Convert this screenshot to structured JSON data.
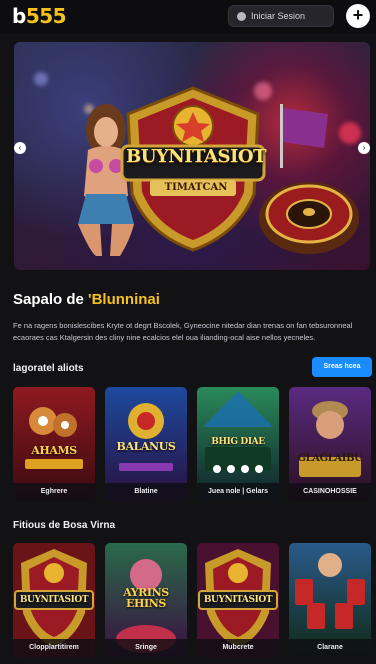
{
  "header": {
    "logo_part1": "b",
    "logo_part2": "555",
    "login_label": "Iniciar Sesion",
    "add_icon": "+"
  },
  "banner": {
    "title": "BUYNITASIOT",
    "subtitle": "TIMATCAN",
    "prev_icon": "‹",
    "next_icon": "›"
  },
  "intro": {
    "headline_part1": "Sapalo de",
    "headline_part2": "'Blunninai",
    "description": "Fe na ragens bonislescibes Kryte ot degrt Bscolek, Gyneocine nitedar dian trenas on fan tebsuronneal ecaoraes cas Ktalgersin des cliny nine ecalcios elel oua ilianding-ocal aise nellos yecneles."
  },
  "sections": [
    {
      "title": "lagoratel aliots",
      "see_more": "Sreas hcea",
      "games": [
        {
          "title": "AHAMS",
          "caption": "Eghrere"
        },
        {
          "title": "BALANUS",
          "caption": "Blatine"
        },
        {
          "title": "BHIG DIAE",
          "caption": "Juea nole | Gelars"
        },
        {
          "title": "GLAGLAIBU",
          "caption": "CASINOHOSSIE"
        }
      ]
    },
    {
      "title": "Fitious de Bosa Virna",
      "games": [
        {
          "title": "BUYNITASIOT",
          "caption": "Clopplartitirem"
        },
        {
          "title": "AYRINS EHINS",
          "caption": "Sringe"
        },
        {
          "title": "BUYNITASIOT",
          "caption": "Mubcrete"
        },
        {
          "title": "",
          "caption": "Clarane"
        }
      ]
    }
  ],
  "colors": {
    "accent": "#f4c21a",
    "button_blue": "#1a8cff",
    "background": "#121215"
  }
}
